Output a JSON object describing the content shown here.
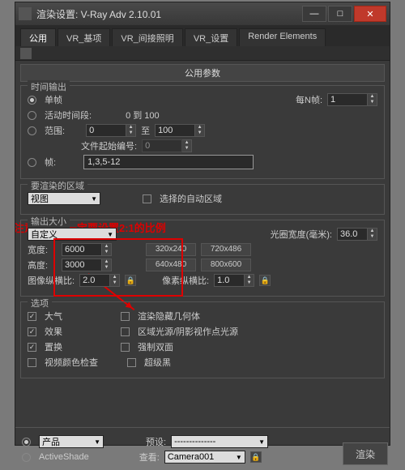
{
  "window": {
    "title": "渲染设置: V-Ray Adv 2.10.01"
  },
  "tabs": [
    "公用",
    "VR_基项",
    "VR_间接照明",
    "VR_设置",
    "Render Elements"
  ],
  "section_header": "公用参数",
  "time_output": {
    "title": "时间输出",
    "single": "单帧",
    "every_n": "每N帧:",
    "every_n_val": "1",
    "active": "活动时间段:",
    "active_range": "0 到 100",
    "range": "范围:",
    "range_from": "0",
    "range_to_label": "至",
    "range_to": "100",
    "file_start": "文件起始编号:",
    "file_start_val": "0",
    "frames": "帧:",
    "frames_val": "1,3,5-12"
  },
  "render_area": {
    "title": "要渲染的区域",
    "view": "视图",
    "auto_region": "选择的自动区域"
  },
  "output_size": {
    "title": "输出大小",
    "custom": "自定义",
    "aperture": "光圈宽度(毫米):",
    "aperture_val": "36.0",
    "width": "宽度:",
    "width_val": "6000",
    "height": "高度:",
    "height_val": "3000",
    "img_aspect": "图像纵横比:",
    "img_aspect_val": "2.0",
    "pixel_aspect": "像素纵横比:",
    "pixel_aspect_val": "1.0",
    "presets": [
      "320x240",
      "720x486",
      "640x480",
      "800x600"
    ]
  },
  "options": {
    "title": "选项",
    "atmo": "大气",
    "hidden": "渲染隐藏几何体",
    "effects": "效果",
    "area_lights": "区域光源/阴影视作点光源",
    "displace": "置换",
    "two_sided": "强制双面",
    "video_color": "视频颜色检查",
    "super_black": "超级黑"
  },
  "annotation": "注意：此处一定要设置2:1的比例",
  "bottom": {
    "product": "产品",
    "preset": "预设:",
    "preset_val": "--------------",
    "activeshade": "ActiveShade",
    "viewport": "查看:",
    "viewport_val": "Camera001",
    "render": "渲染"
  }
}
